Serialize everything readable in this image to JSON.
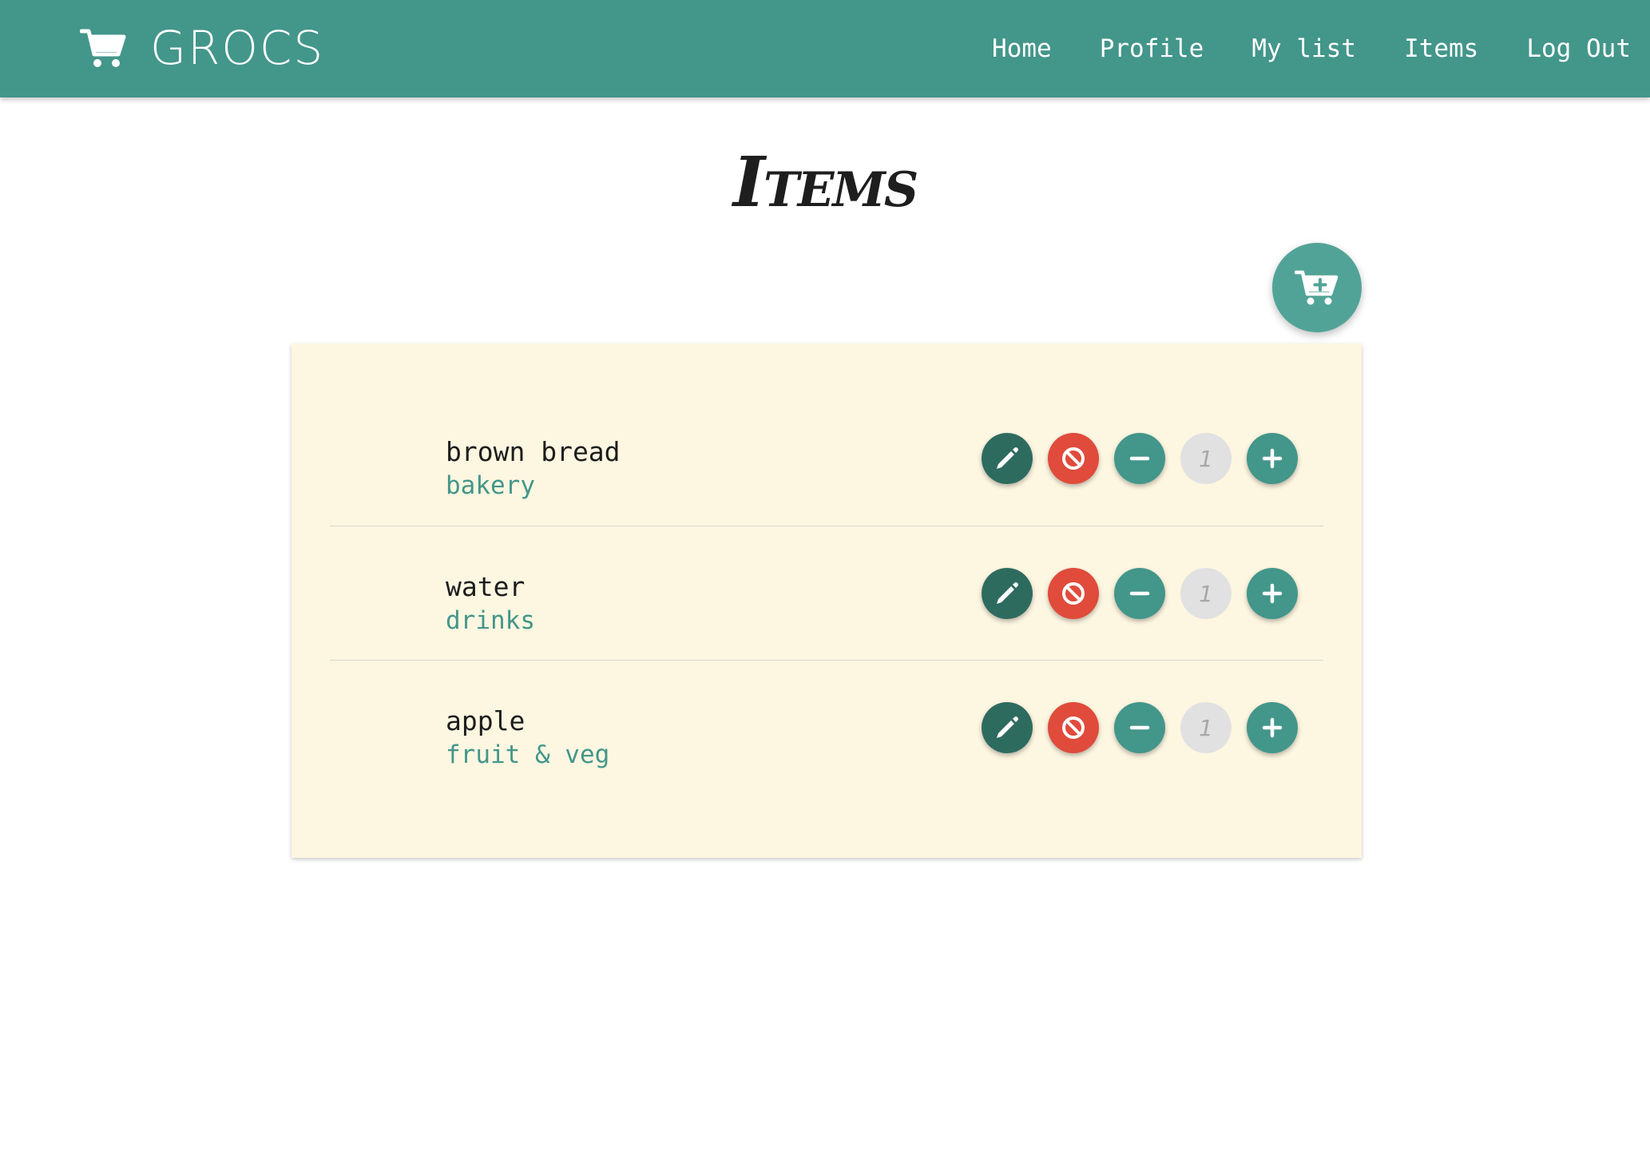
{
  "brand": {
    "name": "GROCS",
    "icon": "shopping-cart-icon"
  },
  "nav": {
    "items": [
      {
        "label": "Home"
      },
      {
        "label": "Profile"
      },
      {
        "label": "My list"
      },
      {
        "label": "Items"
      },
      {
        "label": "Log Out"
      }
    ]
  },
  "page": {
    "title": "Items"
  },
  "add_button": {
    "icon": "cart-plus-icon"
  },
  "items": [
    {
      "name": "brown bread",
      "category": "bakery",
      "quantity": "1"
    },
    {
      "name": "water",
      "category": "drinks",
      "quantity": "1"
    },
    {
      "name": "apple",
      "category": "fruit & veg",
      "quantity": "1"
    }
  ],
  "colors": {
    "primary": "#43968a",
    "edit": "#2e6b5f",
    "delete": "#e04b3b",
    "card_background": "#fdf6e1",
    "quantity_background": "#e1e1e1"
  }
}
